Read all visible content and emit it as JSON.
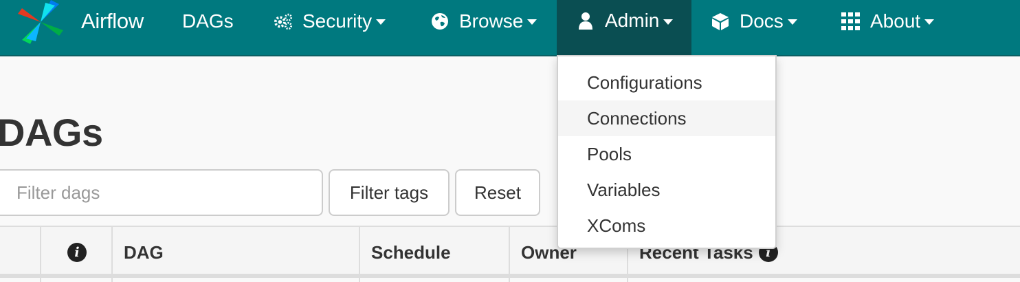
{
  "brand": {
    "name": "Airflow"
  },
  "nav": {
    "dags": "DAGs",
    "security": "Security",
    "browse": "Browse",
    "admin": "Admin",
    "docs": "Docs",
    "about": "About"
  },
  "admin_menu": {
    "items": [
      "Configurations",
      "Connections",
      "Pools",
      "Variables",
      "XComs"
    ],
    "hovered": "Connections"
  },
  "page": {
    "title": "DAGs"
  },
  "filters": {
    "dag_placeholder": "Filter dags",
    "tags_label": "Filter tags",
    "reset_label": "Reset"
  },
  "table": {
    "headers": {
      "dag": "DAG",
      "schedule": "Schedule",
      "owner": "Owner",
      "recent_tasks": "Recent Tasks"
    }
  },
  "icons": {
    "security": "gears-icon",
    "browse": "globe-icon",
    "admin": "user-icon",
    "docs": "cube-icon",
    "about": "grid-icon",
    "info": "info-circle-icon"
  },
  "colors": {
    "navbar": "#00797f",
    "navbar_active": "#0a4e52",
    "dropdown_hover": "#f5f5f5"
  }
}
